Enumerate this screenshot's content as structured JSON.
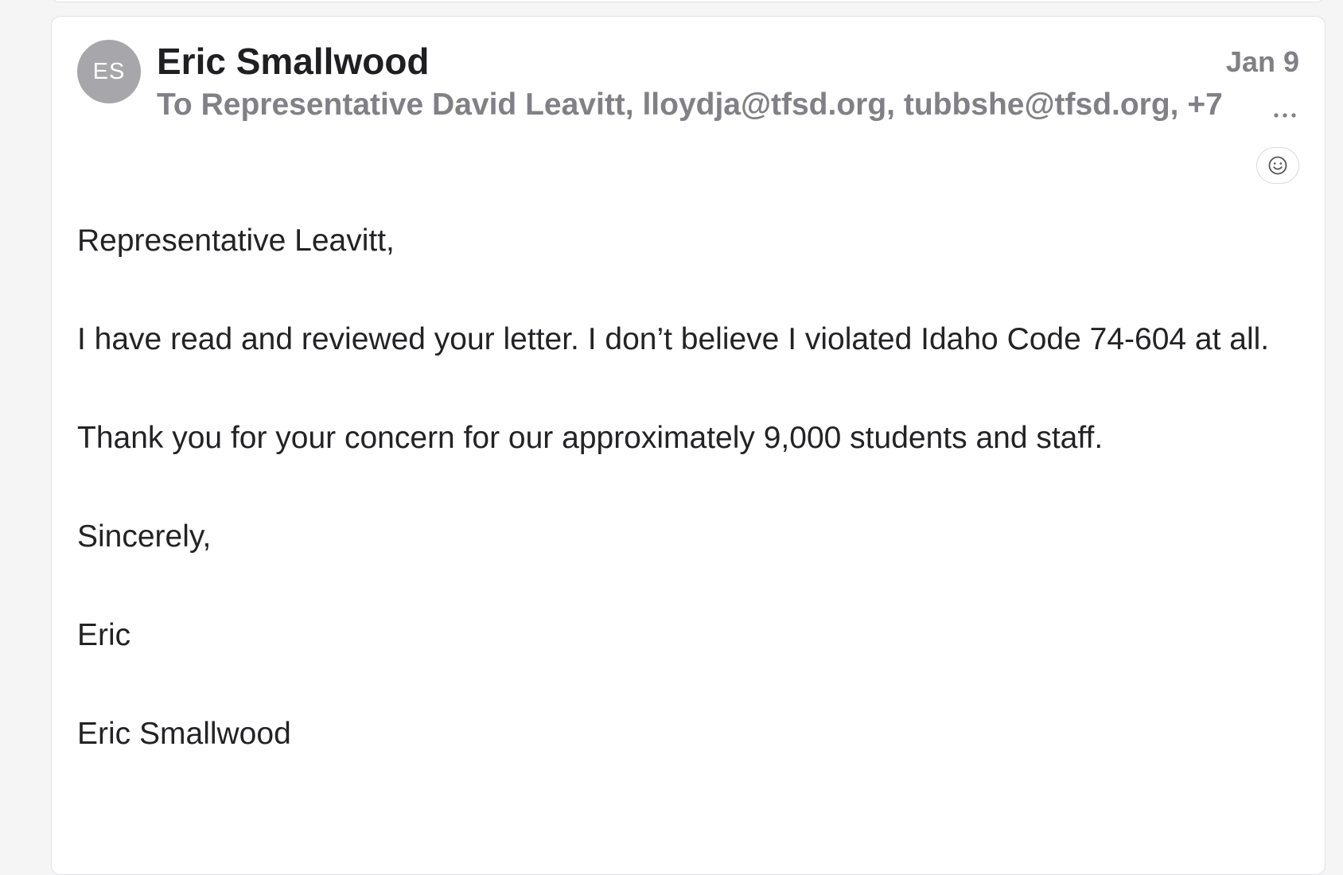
{
  "message": {
    "avatar_initials": "ES",
    "sender_name": "Eric Smallwood",
    "recipients": "To Representative David Leavitt, lloydja@tfsd.org, tubbshe@tfsd.org, +7",
    "date": "Jan 9",
    "more_icon": "ellipsis-icon",
    "reaction_icon": "smiley-icon",
    "body": {
      "greeting": "Representative Leavitt,",
      "paragraph_1": "I have read and reviewed your letter. I don’t believe I violated Idaho Code 74-604 at all.",
      "paragraph_2": "Thank you for your concern for our approximately 9,000 students and staff.",
      "closing": "Sincerely,",
      "signature_first": "Eric",
      "signature_full": "Eric Smallwood"
    }
  },
  "colors": {
    "background": "#f5f5f6",
    "card": "#ffffff",
    "avatar": "#a6a6ab",
    "muted_text": "#808086",
    "primary_text": "#1f1f21"
  }
}
